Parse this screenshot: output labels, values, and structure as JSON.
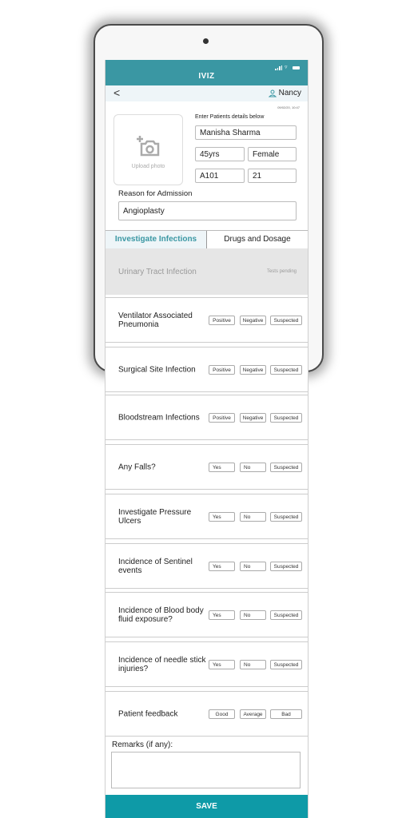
{
  "app": {
    "title": "IVIZ"
  },
  "navbar": {
    "back_label": "<",
    "user_name": "Nancy"
  },
  "form": {
    "timestamp": "09/02/20, 10:47",
    "instruction": "Enter Patients details below",
    "upload_photo_label": "Upload photo",
    "patient_name": "Manisha Sharma",
    "age": "45yrs",
    "gender": "Female",
    "ward": "A101",
    "bed": "21",
    "reason_label": "Reason for Admission",
    "reason": "Angioplasty"
  },
  "tabs": [
    {
      "label": "Investigate Infections",
      "active": true
    },
    {
      "label": "Drugs and Dosage",
      "active": false
    }
  ],
  "uti": {
    "name": "Urinary Tract Infection",
    "status": "Tests pending"
  },
  "rows": [
    {
      "question": "Ventilator Associated Pneumonia",
      "options": [
        "Positive",
        "Negative",
        "Suspected"
      ]
    },
    {
      "question": "Surgical Site Infection",
      "options": [
        "Positive",
        "Negative",
        "Suspected"
      ]
    },
    {
      "question": "Bloodstream Infections",
      "options": [
        "Positive",
        "Negative",
        "Suspected"
      ]
    },
    {
      "question": "Any Falls?",
      "options": [
        "Yes",
        "No",
        "Suspected"
      ]
    },
    {
      "question": "Investigate Pressure Ulcers",
      "options": [
        "Yes",
        "No",
        "Suspected"
      ]
    },
    {
      "question": "Incidence of Sentinel events",
      "options": [
        "Yes",
        "No",
        "Suspected"
      ]
    },
    {
      "question": "Incidence of Blood body fluid exposure?",
      "options": [
        "Yes",
        "No",
        "Suspected"
      ]
    },
    {
      "question": "Incidence of needle stick injuries?",
      "options": [
        "Yes",
        "No",
        "Suspected"
      ]
    },
    {
      "question": "Patient feedback",
      "options": [
        "Good",
        "Average",
        "Bad"
      ]
    }
  ],
  "remarks": {
    "label": "Remarks (if any):",
    "value": ""
  },
  "save_label": "SAVE",
  "colors": {
    "primary": "#3a97a3",
    "save": "#0e9aa7",
    "nav_bg": "#eef5f8"
  }
}
